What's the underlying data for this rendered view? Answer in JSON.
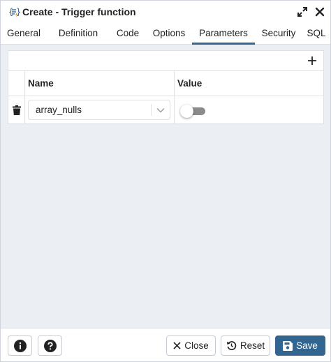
{
  "dialog": {
    "title": "Create - Trigger function",
    "icons": {
      "title": "trigger-function-icon",
      "expand": "expand-icon",
      "close": "close-icon"
    }
  },
  "tabs": [
    {
      "label": "General",
      "active": false
    },
    {
      "label": "Definition",
      "active": false
    },
    {
      "label": "Code",
      "active": false
    },
    {
      "label": "Options",
      "active": false
    },
    {
      "label": "Parameters",
      "active": true
    },
    {
      "label": "Security",
      "active": false
    },
    {
      "label": "SQL",
      "active": false
    }
  ],
  "parameters": {
    "add_icon": "plus-icon",
    "columns": {
      "name": "Name",
      "value": "Value"
    },
    "rows": [
      {
        "name": "array_nulls",
        "value": false,
        "delete_icon": "trash-icon"
      }
    ]
  },
  "footer": {
    "info_icon": "info-icon",
    "help_icon": "help-icon",
    "close_label": "Close",
    "reset_label": "Reset",
    "save_label": "Save"
  },
  "colors": {
    "accent": "#326690",
    "content_bg": "#ebeef3",
    "toggle_off": "#8b8b8b"
  }
}
